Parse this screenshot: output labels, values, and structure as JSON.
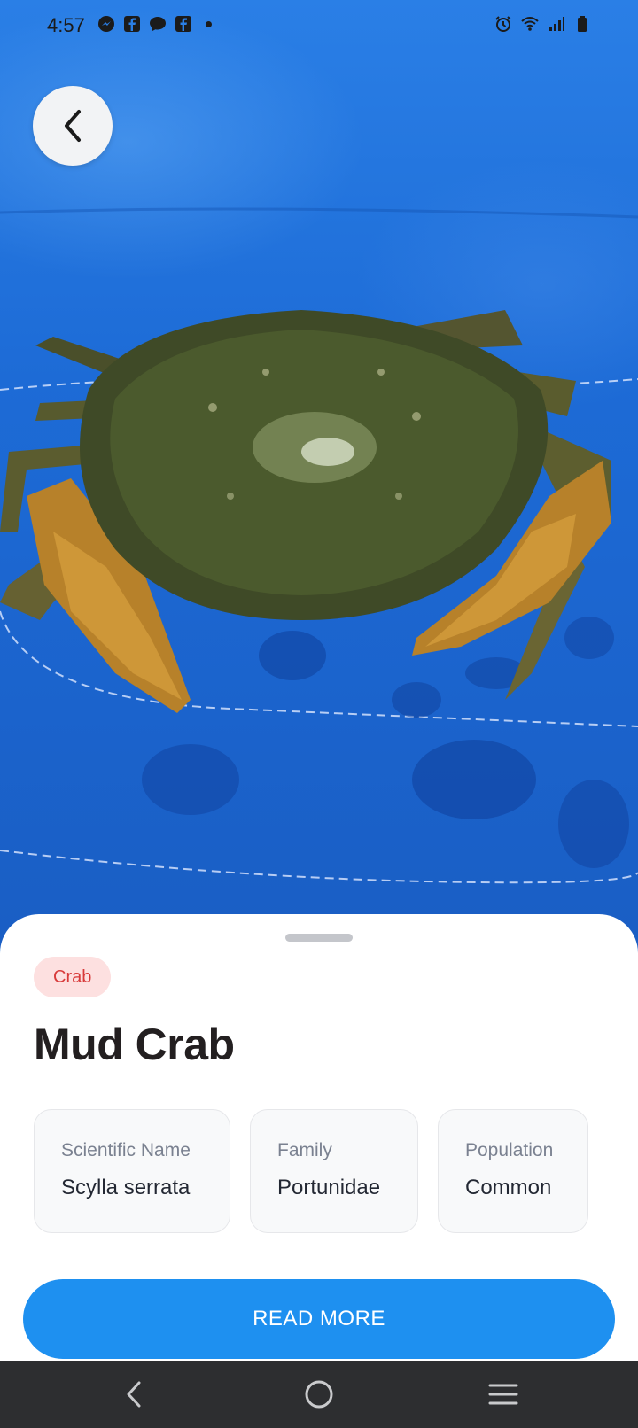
{
  "status_bar": {
    "time": "4:57",
    "left_icons": [
      "messenger-icon",
      "facebook-icon",
      "chat-bubble-icon",
      "facebook-icon",
      "dot-icon"
    ],
    "right_icons": [
      "alarm-icon",
      "wifi-icon",
      "signal-icon",
      "battery-icon"
    ]
  },
  "header": {
    "back_icon": "chevron-left-icon"
  },
  "sheet": {
    "tag": "Crab",
    "title": "Mud Crab",
    "info_cards": [
      {
        "label": "Scientific Name",
        "value": "Scylla serrata"
      },
      {
        "label": "Family",
        "value": "Portunidae"
      },
      {
        "label": "Population",
        "value": "Common"
      }
    ],
    "read_more_label": "READ MORE"
  },
  "nav_bar": {
    "icons": [
      "nav-back-icon",
      "nav-home-icon",
      "nav-recents-icon"
    ]
  },
  "colors": {
    "tag_bg": "#fde0e0",
    "tag_text": "#d83b3b",
    "button": "#1e90f0",
    "cloth": "#1d6bd6"
  }
}
